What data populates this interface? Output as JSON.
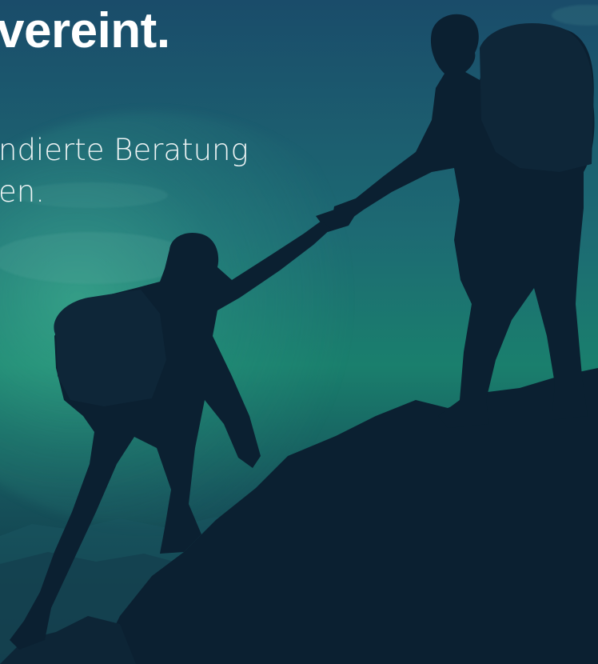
{
  "hero": {
    "headline": "vereint.",
    "subline_1": "ndierte Beratung",
    "subline_2": "en."
  },
  "colors": {
    "sky_top": "#1a4c6a",
    "sky_mid": "#1a7f6d",
    "silhouette": "#0b2031",
    "text": "#ffffff"
  },
  "image": {
    "subject": "two-climbers-helping-hand"
  }
}
